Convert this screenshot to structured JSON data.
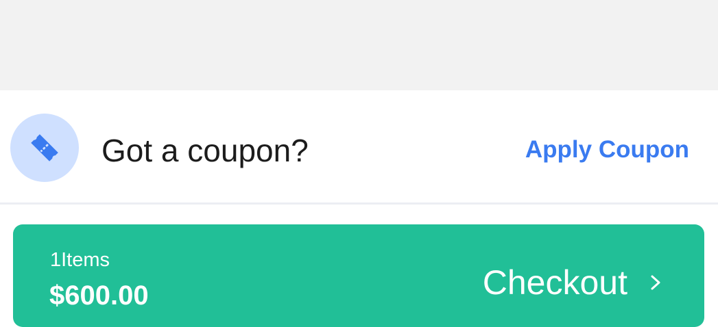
{
  "coupon": {
    "icon": "ticket-icon",
    "title": "Got a coupon?",
    "action_label": "Apply Coupon"
  },
  "checkout": {
    "items_count": "1Items",
    "total": "$600.00",
    "label": "Checkout",
    "chevron_icon": "chevron-right-icon"
  },
  "colors": {
    "accent_blue": "#3a7bf0",
    "icon_bg": "#cfe0ff",
    "checkout_green": "#21bf97",
    "top_bg": "#f2f2f2"
  }
}
